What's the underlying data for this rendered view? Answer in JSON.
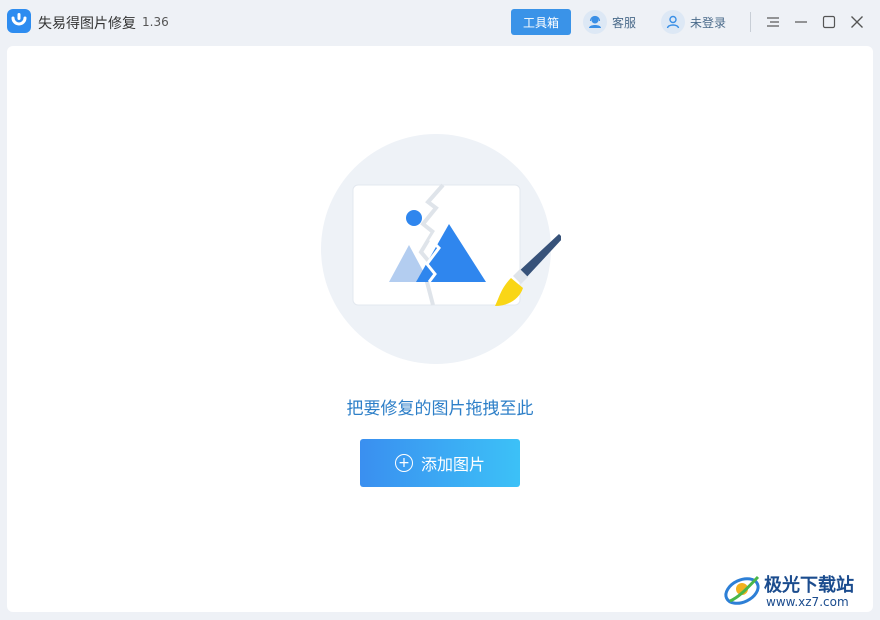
{
  "app": {
    "title": "失易得图片修复",
    "version": "1.36"
  },
  "header": {
    "toolbox_label": "工具箱",
    "service_label": "客服",
    "login_label": "未登录"
  },
  "main": {
    "drop_hint": "把要修复的图片拖拽至此",
    "add_button_label": "添加图片"
  },
  "watermark": {
    "site_name": "极光下载站",
    "url": "www.xz7.com"
  },
  "colors": {
    "accent": "#3a93e8",
    "hint_text": "#2d7fc8"
  },
  "icons": [
    "app-logo-icon",
    "service-icon",
    "user-icon",
    "menu-icon",
    "minimize-icon",
    "maximize-icon",
    "close-icon",
    "plus-circle-icon"
  ]
}
